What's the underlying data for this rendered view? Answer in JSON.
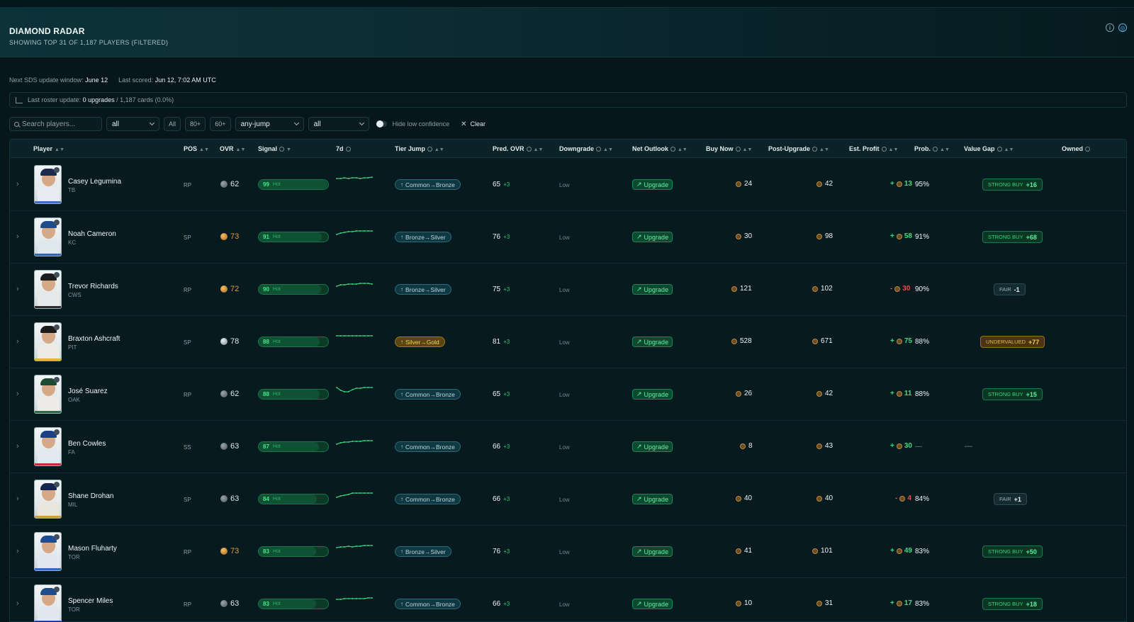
{
  "header": {
    "title": "DIAMOND RADAR",
    "subtitle": "SHOWING TOP 31 OF 1,187 PLAYERS (FILTERED)",
    "info_icon": "info-icon",
    "radar_icon": "radar-icon"
  },
  "meta": {
    "next_label": "Next SDS update window:",
    "next_value": "June 12",
    "scored_label": "Last scored:",
    "scored_value": "Jun 12, 7:02 AM UTC"
  },
  "roster": {
    "label": "Last roster update:",
    "upgrades": "0 upgrades",
    "rest": "/ 1,187 cards (0.0%)"
  },
  "filters": {
    "search_placeholder": "Search players...",
    "select1": "all",
    "chips": [
      "All",
      "80+",
      "60+"
    ],
    "select2": "any-jump",
    "select3": "all",
    "toggle_label": "Hide low confidence",
    "clear_label": "Clear"
  },
  "columns": {
    "player": "Player",
    "pos": "POS",
    "ovr": "OVR",
    "signal": "Signal",
    "d7": "7d",
    "tier": "Tier Jump",
    "pred": "Pred. OVR",
    "downgrade": "Downgrade",
    "outlook": "Net Outlook",
    "buy": "Buy Now",
    "post": "Post-Upgrade",
    "profit": "Est. Profit",
    "prob": "Prob.",
    "vgap": "Value Gap",
    "owned": "Owned"
  },
  "rows": [
    {
      "name": "Casey Legumina",
      "team": "TB",
      "pos": "RP",
      "ovr": "62",
      "ovr_tier": "bronze",
      "signal": "99",
      "signal_label": "Hot",
      "signal_pct": 99,
      "tier": "Common→Bronze",
      "tier_gold": false,
      "pred": "65",
      "pred_delta": "+3",
      "downgrade": "Low",
      "outlook": "Upgrade",
      "buy": "24",
      "post": "42",
      "profit_sign": "+",
      "profit": "13",
      "profit_neg": false,
      "prob": "95%",
      "vgap_type": "buy",
      "vgap_label": "STRONG BUY",
      "vgap_val": "+16",
      "trend": [
        10,
        10,
        9,
        10,
        9,
        9,
        10,
        9,
        9,
        8
      ],
      "colors": {
        "cap": "#1b2a4f",
        "body": "#e8ecf1",
        "stripe": "#3c6fc4"
      }
    },
    {
      "name": "Noah Cameron",
      "team": "KC",
      "pos": "SP",
      "ovr": "73",
      "ovr_tier": "gold",
      "signal": "91",
      "signal_label": "Hot",
      "signal_pct": 91,
      "tier": "Bronze→Silver",
      "tier_gold": false,
      "pred": "76",
      "pred_delta": "+3",
      "downgrade": "Low",
      "outlook": "Upgrade",
      "buy": "30",
      "post": "98",
      "profit_sign": "+",
      "profit": "58",
      "profit_neg": false,
      "prob": "91%",
      "vgap_type": "buy",
      "vgap_label": "STRONG BUY",
      "vgap_val": "+68",
      "trend": [
        15,
        13,
        12,
        11,
        11,
        10,
        10,
        10,
        10,
        10
      ],
      "colors": {
        "cap": "#1f4c8a",
        "body": "#dfe7ef",
        "stripe": "#2f66b8"
      }
    },
    {
      "name": "Trevor Richards",
      "team": "CWS",
      "pos": "RP",
      "ovr": "72",
      "ovr_tier": "gold",
      "signal": "90",
      "signal_label": "Hot",
      "signal_pct": 90,
      "tier": "Bronze→Silver",
      "tier_gold": false,
      "pred": "75",
      "pred_delta": "+3",
      "downgrade": "Low",
      "outlook": "Upgrade",
      "buy": "121",
      "post": "102",
      "profit_sign": "-",
      "profit": "30",
      "profit_neg": true,
      "prob": "90%",
      "vgap_type": "fair",
      "vgap_label": "FAIR",
      "vgap_val": "-1",
      "trend": [
        14,
        12,
        12,
        11,
        11,
        11,
        10,
        10,
        10,
        11
      ],
      "colors": {
        "cap": "#1d1d1f",
        "body": "#e6e8ea",
        "stripe": "#2b2b2e"
      }
    },
    {
      "name": "Braxton Ashcraft",
      "team": "PIT",
      "pos": "SP",
      "ovr": "78",
      "ovr_tier": "silver",
      "signal": "88",
      "signal_label": "Hot",
      "signal_pct": 88,
      "tier": "Silver→Gold",
      "tier_gold": true,
      "pred": "81",
      "pred_delta": "+3",
      "downgrade": "Low",
      "outlook": "Upgrade",
      "buy": "528",
      "post": "671",
      "profit_sign": "+",
      "profit": "75",
      "profit_neg": false,
      "prob": "88%",
      "vgap_type": "under",
      "vgap_label": "UNDERVALUED",
      "vgap_val": "+77",
      "trend": [
        10,
        10,
        10,
        10,
        10,
        10,
        10,
        10,
        10,
        10
      ],
      "colors": {
        "cap": "#1b1b1c",
        "body": "#ecebe6",
        "stripe": "#e0b530"
      }
    },
    {
      "name": "José Suarez",
      "team": "OAK",
      "pos": "RP",
      "ovr": "62",
      "ovr_tier": "bronze",
      "signal": "88",
      "signal_label": "Hot",
      "signal_pct": 88,
      "tier": "Common→Bronze",
      "tier_gold": false,
      "pred": "65",
      "pred_delta": "+3",
      "downgrade": "Low",
      "outlook": "Upgrade",
      "buy": "26",
      "post": "42",
      "profit_sign": "+",
      "profit": "11",
      "profit_neg": false,
      "prob": "88%",
      "vgap_type": "buy",
      "vgap_label": "STRONG BUY",
      "vgap_val": "+15",
      "trend": [
        9,
        13,
        15,
        15,
        12,
        10,
        10,
        9,
        9,
        9
      ],
      "colors": {
        "cap": "#1d4a33",
        "body": "#edece8",
        "stripe": "#2d6b48"
      }
    },
    {
      "name": "Ben Cowles",
      "team": "FA",
      "pos": "SS",
      "ovr": "63",
      "ovr_tier": "bronze",
      "signal": "87",
      "signal_label": "Hot",
      "signal_pct": 87,
      "tier": "Common→Bronze",
      "tier_gold": false,
      "pred": "66",
      "pred_delta": "+3",
      "downgrade": "Low",
      "outlook": "Upgrade",
      "buy": "8",
      "post": "43",
      "profit_sign": "+",
      "profit": "30",
      "profit_neg": false,
      "prob": "—",
      "vgap_type": "none",
      "vgap_label": "—",
      "vgap_val": "",
      "trend": [
        15,
        13,
        12,
        12,
        11,
        11,
        11,
        10,
        10,
        10
      ],
      "colors": {
        "cap": "#1c3f86",
        "body": "#e3e9f1",
        "stripe": "#c23030"
      }
    },
    {
      "name": "Shane Drohan",
      "team": "MIL",
      "pos": "SP",
      "ovr": "63",
      "ovr_tier": "bronze",
      "signal": "84",
      "signal_label": "Hot",
      "signal_pct": 84,
      "tier": "Common→Bronze",
      "tier_gold": false,
      "pred": "66",
      "pred_delta": "+3",
      "downgrade": "Low",
      "outlook": "Upgrade",
      "buy": "40",
      "post": "40",
      "profit_sign": "-",
      "profit": "4",
      "profit_neg": true,
      "prob": "84%",
      "vgap_type": "fair",
      "vgap_label": "FAIR",
      "vgap_val": "+1",
      "trend": [
        16,
        14,
        13,
        12,
        10,
        10,
        10,
        10,
        10,
        10
      ],
      "colors": {
        "cap": "#14254f",
        "body": "#e9e6dc",
        "stripe": "#c9a33a"
      }
    },
    {
      "name": "Mason Fluharty",
      "team": "TOR",
      "pos": "RP",
      "ovr": "73",
      "ovr_tier": "gold",
      "signal": "83",
      "signal_label": "Hot",
      "signal_pct": 83,
      "tier": "Bronze→Silver",
      "tier_gold": false,
      "pred": "76",
      "pred_delta": "+3",
      "downgrade": "Low",
      "outlook": "Upgrade",
      "buy": "41",
      "post": "101",
      "profit_sign": "+",
      "profit": "49",
      "profit_neg": false,
      "prob": "83%",
      "vgap_type": "buy",
      "vgap_label": "STRONG BUY",
      "vgap_val": "+50",
      "trend": [
        13,
        12,
        12,
        11,
        12,
        11,
        11,
        10,
        10,
        10
      ],
      "colors": {
        "cap": "#1e4c8e",
        "body": "#e1e8f0",
        "stripe": "#2f6ec0"
      }
    },
    {
      "name": "Spencer Miles",
      "team": "TOR",
      "pos": "RP",
      "ovr": "63",
      "ovr_tier": "bronze",
      "signal": "83",
      "signal_label": "Hot",
      "signal_pct": 83,
      "tier": "Common→Bronze",
      "tier_gold": false,
      "pred": "66",
      "pred_delta": "+3",
      "downgrade": "Low",
      "outlook": "Upgrade",
      "buy": "10",
      "post": "31",
      "profit_sign": "+",
      "profit": "17",
      "profit_neg": false,
      "prob": "83%",
      "vgap_type": "buy",
      "vgap_label": "STRONG BUY",
      "vgap_val": "+18",
      "trend": [
        12,
        12,
        11,
        11,
        11,
        11,
        11,
        11,
        10,
        10
      ],
      "colors": {
        "cap": "#1e4c8e",
        "body": "#e1e8f0",
        "stripe": "#2f6ec0"
      }
    }
  ]
}
